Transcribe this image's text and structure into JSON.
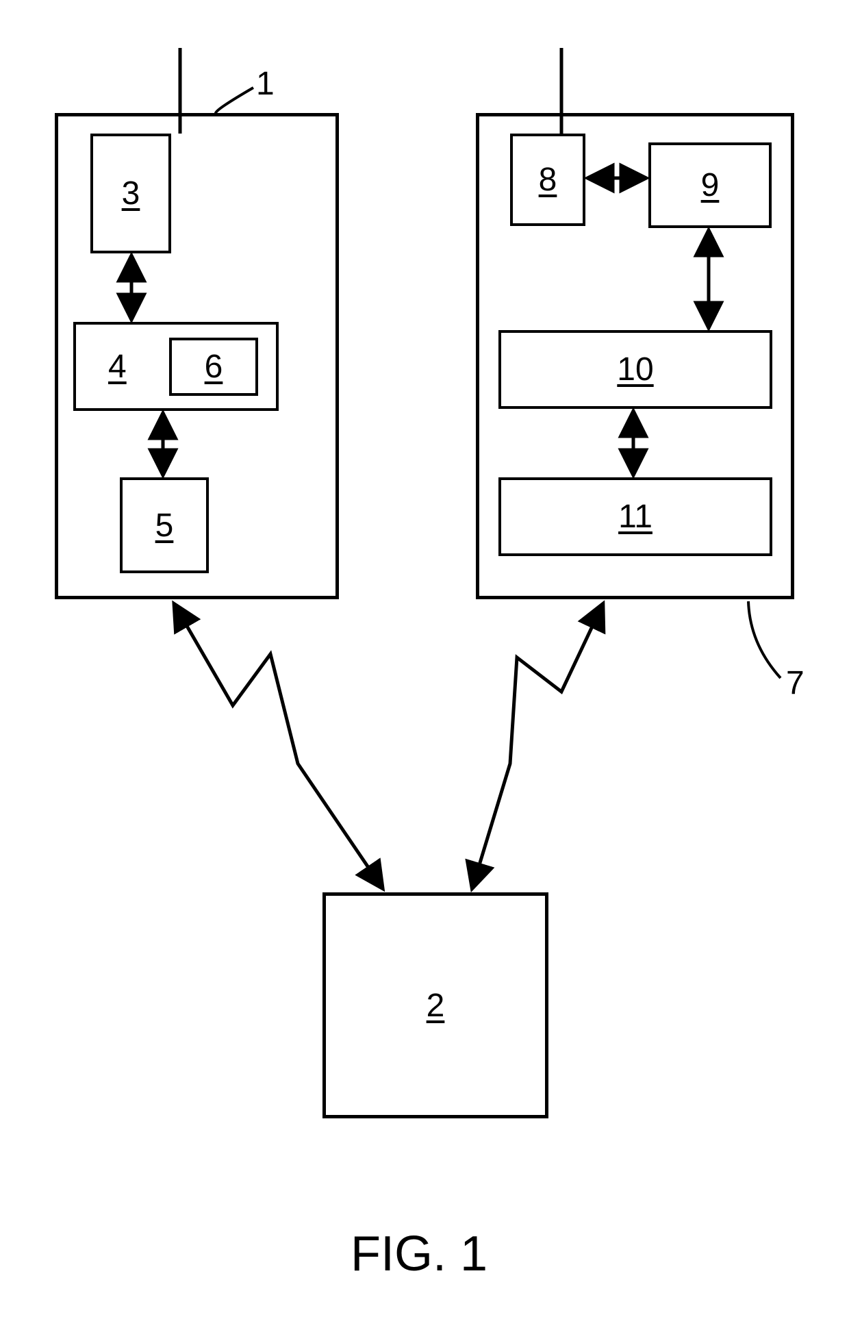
{
  "figure_caption": "FIG. 1",
  "left_container_label": "1",
  "right_container_label": "7",
  "bottom_box_label": "2",
  "left": {
    "box3": "3",
    "box4": "4",
    "box5": "5",
    "box6": "6"
  },
  "right": {
    "box8": "8",
    "box9": "9",
    "box10": "10",
    "box11": "11"
  }
}
